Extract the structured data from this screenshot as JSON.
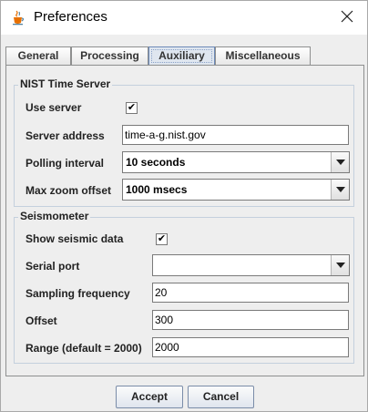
{
  "window": {
    "title": "Preferences"
  },
  "tabs": [
    {
      "label": "General"
    },
    {
      "label": "Processing"
    },
    {
      "label": "Auxiliary"
    },
    {
      "label": "Miscellaneous"
    }
  ],
  "active_tab": "Auxiliary",
  "nist": {
    "title": "NIST Time Server",
    "use_server_label": "Use server",
    "use_server_checked": true,
    "server_address_label": "Server address",
    "server_address_value": "time-a-g.nist.gov",
    "polling_label": "Polling interval",
    "polling_value": "10 seconds",
    "max_zoom_label": "Max zoom offset",
    "max_zoom_value": "1000 msecs"
  },
  "seismo": {
    "title": "Seismometer",
    "show_label": "Show seismic data",
    "show_checked": true,
    "serial_port_label": "Serial port",
    "serial_port_value": "",
    "sampling_label": "Sampling frequency",
    "sampling_value": "20",
    "offset_label": "Offset",
    "offset_value": "300",
    "range_label": "Range (default = 2000)",
    "range_value": "2000"
  },
  "buttons": {
    "accept": "Accept",
    "cancel": "Cancel"
  },
  "icons": {
    "app": "java-cup-icon",
    "close": "close-icon",
    "check": "✔",
    "dropdown": "chevron-down-icon"
  }
}
